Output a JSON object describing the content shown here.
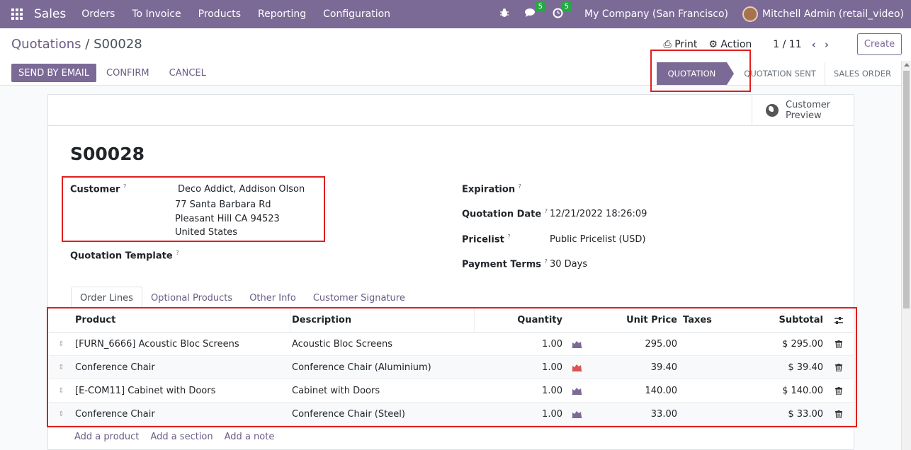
{
  "navbar": {
    "app_name": "Sales",
    "menu": [
      "Orders",
      "To Invoice",
      "Products",
      "Reporting",
      "Configuration"
    ],
    "messages_count": "5",
    "activities_count": "5",
    "company": "My Company (San Francisco)",
    "user": "Mitchell Admin (retail_video)"
  },
  "breadcrumb": {
    "parent": "Quotations",
    "separator": " / ",
    "current": "S00028"
  },
  "actions": {
    "print": "Print",
    "action": "Action",
    "pager": "1 / 11",
    "create": "Create"
  },
  "buttons": {
    "send_email": "SEND BY EMAIL",
    "confirm": "CONFIRM",
    "cancel": "CANCEL"
  },
  "status": {
    "stages": [
      "QUOTATION",
      "QUOTATION SENT",
      "SALES ORDER"
    ],
    "current": "QUOTATION"
  },
  "preview_button": "Customer Preview",
  "record": {
    "name": "S00028",
    "customer_label": "Customer",
    "customer_name": "Deco Addict, Addison Olson",
    "customer_address": [
      "77 Santa Barbara Rd",
      "Pleasant Hill CA 94523",
      "United States"
    ],
    "template_label": "Quotation Template",
    "expiration_label": "Expiration",
    "quotation_date_label": "Quotation Date",
    "quotation_date": "12/21/2022 18:26:09",
    "pricelist_label": "Pricelist",
    "pricelist": "Public Pricelist (USD)",
    "payment_terms_label": "Payment Terms",
    "payment_terms": "30 Days",
    "help_mark": "?"
  },
  "tabs": [
    "Order Lines",
    "Optional Products",
    "Other Info",
    "Customer Signature"
  ],
  "table": {
    "headers": {
      "product": "Product",
      "description": "Description",
      "quantity": "Quantity",
      "unit_price": "Unit Price",
      "taxes": "Taxes",
      "subtotal": "Subtotal"
    },
    "rows": [
      {
        "product": "[FURN_6666] Acoustic Bloc Screens",
        "description": "Acoustic Bloc Screens",
        "quantity": "1.00",
        "unit_price": "295.00",
        "taxes": "",
        "subtotal": "$ 295.00",
        "chart_color": "#7c6a96"
      },
      {
        "product": "Conference Chair",
        "description": "Conference Chair (Aluminium)",
        "quantity": "1.00",
        "unit_price": "39.40",
        "taxes": "",
        "subtotal": "$ 39.40",
        "chart_color": "#d9534f"
      },
      {
        "product": "[E-COM11] Cabinet with Doors",
        "description": "Cabinet with Doors",
        "quantity": "1.00",
        "unit_price": "140.00",
        "taxes": "",
        "subtotal": "$ 140.00",
        "chart_color": "#7c6a96"
      },
      {
        "product": "Conference Chair",
        "description": "Conference Chair (Steel)",
        "quantity": "1.00",
        "unit_price": "33.00",
        "taxes": "",
        "subtotal": "$ 33.00",
        "chart_color": "#7c6a96"
      }
    ],
    "add_links": [
      "Add a product",
      "Add a section",
      "Add a note"
    ]
  }
}
